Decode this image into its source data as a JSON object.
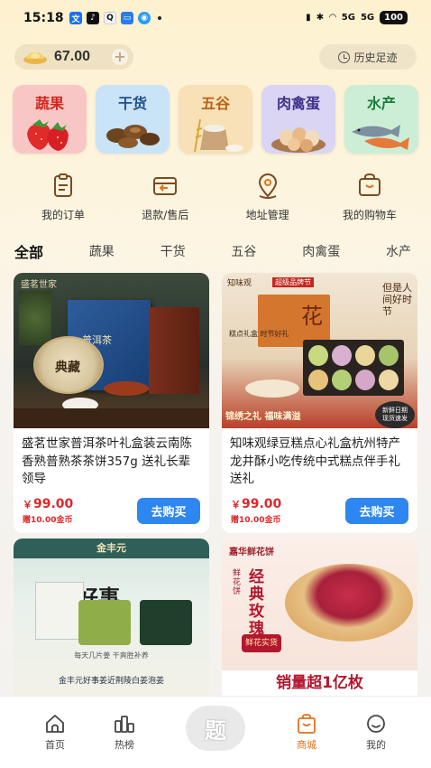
{
  "status_bar": {
    "time": "15:18",
    "network_a": "5G",
    "network_b": "5G",
    "battery": "100"
  },
  "header": {
    "coin_balance": "67.00",
    "history_label": "历史足迹"
  },
  "categories": [
    {
      "label": "蔬果",
      "bg": "#f8c7c5",
      "color": "#d1281f",
      "icon": "strawberry-icon"
    },
    {
      "label": "干货",
      "bg": "#c9e3f7",
      "color": "#1f4f86",
      "icon": "mushroom-icon"
    },
    {
      "label": "五谷",
      "bg": "#f8e0b7",
      "color": "#b96314",
      "icon": "grain-icon"
    },
    {
      "label": "肉禽蛋",
      "bg": "#d9d5f3",
      "color": "#3e2f8a",
      "icon": "egg-icon"
    },
    {
      "label": "水产",
      "bg": "#cdeed6",
      "color": "#1e7a3a",
      "icon": "fish-icon"
    }
  ],
  "menu": [
    {
      "label": "我的订单",
      "icon": "order-icon"
    },
    {
      "label": "退款/售后",
      "icon": "refund-icon"
    },
    {
      "label": "地址管理",
      "icon": "location-icon"
    },
    {
      "label": "我的购物车",
      "icon": "cart-icon"
    }
  ],
  "tabs": [
    "全部",
    "蔬果",
    "干货",
    "五谷",
    "肉禽蛋",
    "水产"
  ],
  "products": [
    {
      "title": "盛茗世家普洱茶叶礼盒装云南陈香熟普熟茶茶饼357g 送礼长辈领导",
      "price_currency": "￥",
      "price": "99.00",
      "bonus": "赠10.00金币",
      "buy_label": "去购买",
      "img_brand": "盛茗世家",
      "img_text_1": "普洱茶",
      "img_text_2": "典藏"
    },
    {
      "title": "知味观绿豆糕点心礼盒杭州特产龙井酥小吃传统中式糕点伴手礼送礼",
      "price_currency": "￥",
      "price": "99.00",
      "bonus": "赠10.00金币",
      "buy_label": "去购买",
      "img_brand": "知味观",
      "img_tag": "超级品牌节",
      "img_text_1": "糕点礼盒 时节好礼",
      "img_text_2": "锦绣之礼 福味满溢",
      "img_badge": "新鲜日期 现货速发",
      "img_side": "但是人间好时节",
      "img_flower": "花"
    },
    {
      "img_brand": "金丰元",
      "img_text_1": "好事",
      "img_text_2": "金丰元好事姜近荆陵白姜泡姜",
      "img_text_3": "每天几片姜 干爽胜补养"
    },
    {
      "img_brand": "嘉华鲜花饼",
      "img_text_1": "经典玫瑰饼",
      "img_text_2": "销量超1亿枚",
      "img_badge": "鲜花实货",
      "img_side": "鲜花饼"
    }
  ],
  "bottom_nav": {
    "items": [
      {
        "label": "首页",
        "icon": "home-icon"
      },
      {
        "label": "热榜",
        "icon": "hot-list-icon"
      },
      {
        "label": "商城",
        "icon": "mall-icon",
        "active": true
      },
      {
        "label": "我的",
        "icon": "profile-icon"
      }
    ],
    "center_label": "题"
  }
}
